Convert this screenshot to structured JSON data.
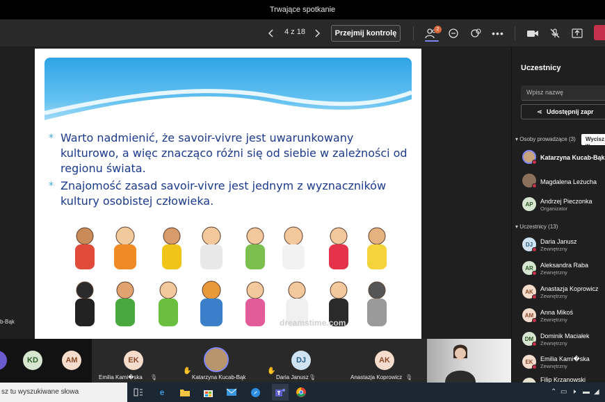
{
  "window": {
    "title": "Trwające spotkanie"
  },
  "toolbar": {
    "page_indicator": "4 z 18",
    "take_control_label": "Przejmij kontrolę",
    "participants_badge": "2"
  },
  "slide": {
    "bullets": [
      "Warto nadmienić, że savoir-vivre jest uwarunkowany kulturowo, a więc znacząco różni się od siebie w zależności od regionu świata.",
      "Znajomość zasad savoir-vivre jest jednym z wyznaczników kultury osobistej człowieka."
    ],
    "bullet_mark": "*",
    "watermark": "dreamstime.com"
  },
  "stage": {
    "presenter_label_partial": "b-Bąk"
  },
  "panel": {
    "title": "Uczestnicy",
    "search_placeholder": "Wpisz nazwę",
    "share_label": "Udostępnij zapr",
    "presenters_section": "Osoby prowadzące (3)",
    "mute_all_label": "Wycisz w",
    "attendees_section": "Uczestnicy (13)",
    "presenters": [
      {
        "initials": "",
        "name": "Katarzyna Kucab-Bąk",
        "sub": ""
      },
      {
        "initials": "",
        "name": "Magdalena Leżucha",
        "sub": ""
      },
      {
        "initials": "AP",
        "name": "Andrzej Pieczonka",
        "sub": "Organizator"
      }
    ],
    "attendees": [
      {
        "initials": "DJ",
        "name": "Daria Janusz",
        "sub": "Zewnętrzny"
      },
      {
        "initials": "AR",
        "name": "Aleksandra Raba",
        "sub": "Zewnętrzny"
      },
      {
        "initials": "AK",
        "name": "Anastazja Koprowicz",
        "sub": "Zewnętrzny"
      },
      {
        "initials": "AM",
        "name": "Anna Mikoś",
        "sub": "Zewnętrzny"
      },
      {
        "initials": "DM",
        "name": "Dominik Maciałek",
        "sub": "Zewnętrzny"
      },
      {
        "initials": "EK",
        "name": "Emilia Kami�ska",
        "sub": "Zewnętrzny"
      },
      {
        "initials": "",
        "name": "Filip Krzanowski",
        "sub": ""
      }
    ]
  },
  "strip": {
    "tiles": [
      {
        "initials": "KD",
        "label": ""
      },
      {
        "initials": "AM",
        "label": ""
      },
      {
        "initials": "EK",
        "label": "Emilia Kami�ska"
      },
      {
        "initials": "",
        "label": "Katarzyna Kucab-Bąk"
      },
      {
        "initials": "DJ",
        "label": "Daria Janusz"
      },
      {
        "initials": "AK",
        "label": "Anastazja Koprowicz"
      }
    ]
  },
  "taskbar": {
    "search_text": "sz tu wyszukiwane słowa"
  },
  "colors": {
    "accent": "#7f85f5",
    "leave": "#c4314b",
    "slide_text": "#1b3a8c",
    "badge": "#d86a3f"
  }
}
